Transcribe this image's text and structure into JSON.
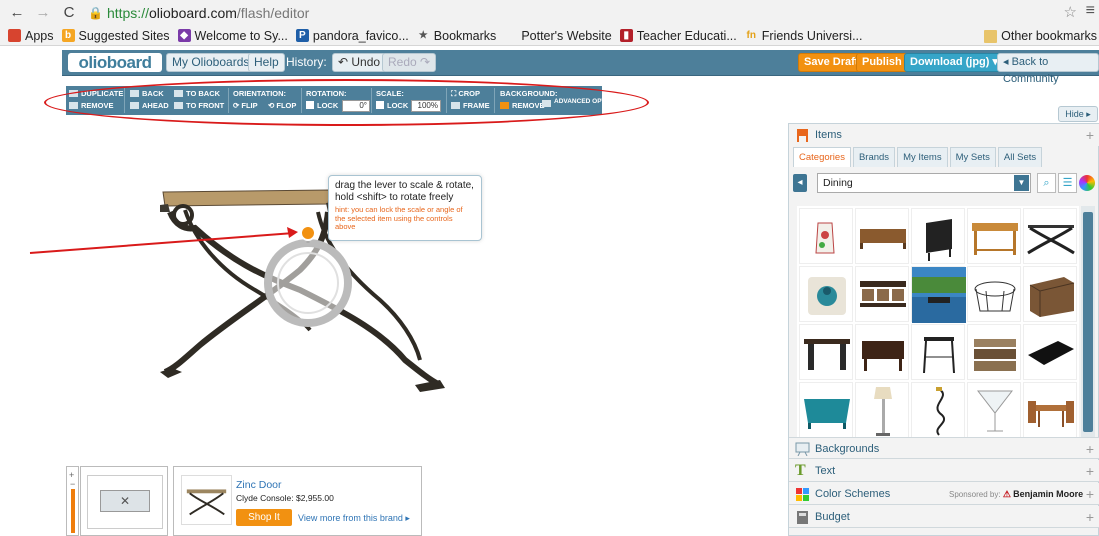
{
  "browser": {
    "url_scheme": "https://",
    "url_host": "olioboard.com",
    "url_path": "/flash/editor",
    "bookmarks": [
      {
        "label": "Apps",
        "icon": "apps-grid-icon",
        "color": "#d7442f"
      },
      {
        "label": "Suggested Sites",
        "icon": "bing-icon",
        "color": "#f5a623"
      },
      {
        "label": "Welcome to Sy...",
        "icon": "diamond-icon",
        "color": "#7a3aa8"
      },
      {
        "label": "pandora_favico...",
        "icon": "pandora-icon",
        "color": "#1f5fa8"
      },
      {
        "label": "Bookmarks",
        "icon": "star-icon",
        "color": "#555555"
      },
      {
        "label": "Potter's Website",
        "icon": "page-icon",
        "color": "#cccccc"
      },
      {
        "label": "Teacher Educati...",
        "icon": "square-icon",
        "color": "#b3202a"
      },
      {
        "label": "Friends Universi...",
        "icon": "fm-icon",
        "color": "#e3a21a"
      }
    ],
    "other_bookmarks": "Other bookmarks"
  },
  "header": {
    "logo": "olioboard",
    "my_boards": "My Olioboards ♥",
    "help": "Help",
    "history": "History:",
    "undo": "↶ Undo",
    "redo": "Redo ↷",
    "save_draft": "Save Draft",
    "publish": "Publish",
    "download": "Download (jpg) ▾",
    "back": "◂ Back to Community"
  },
  "toolbar": {
    "duplicate": "DUPLICATE",
    "remove": "REMOVE",
    "back": "BACK",
    "ahead": "AHEAD",
    "to_back": "TO BACK",
    "to_front": "TO FRONT",
    "orientation": "ORIENTATION:",
    "flip": "FLIP",
    "flop": "FLOP",
    "rotation": "ROTATION:",
    "rot_lock": "LOCK",
    "rot_value": "0°",
    "scale": "SCALE:",
    "scale_lock": "LOCK",
    "scale_value": "100%",
    "crop": "CROP",
    "frame": "FRAME",
    "background": "BACKGROUND:",
    "bg_remove": "REMOVE",
    "advanced": "ADVANCED OPTIONS"
  },
  "tooltip": {
    "main": "drag the lever to scale & rotate, hold <shift> to rotate freely",
    "hint": "hint: you can lock the scale or angle of the selected item using the controls above"
  },
  "product": {
    "brand": "Zinc Door",
    "name": "Clyde Console: $2,955.00",
    "shop": "Shop It",
    "view_more": "View more from this brand ▸"
  },
  "right_panel": {
    "hide": "Hide ▸",
    "items": "Items",
    "tabs": [
      "Categories",
      "Brands",
      "My Items",
      "My Sets",
      "All Sets"
    ],
    "category": "Dining",
    "sections": [
      {
        "label": "Backgrounds"
      },
      {
        "label": "Text"
      },
      {
        "label": "Color Schemes"
      },
      {
        "label": "Budget"
      }
    ],
    "sponsor_prefix": "Sponsored by:",
    "sponsor": "Benjamin Moore"
  }
}
